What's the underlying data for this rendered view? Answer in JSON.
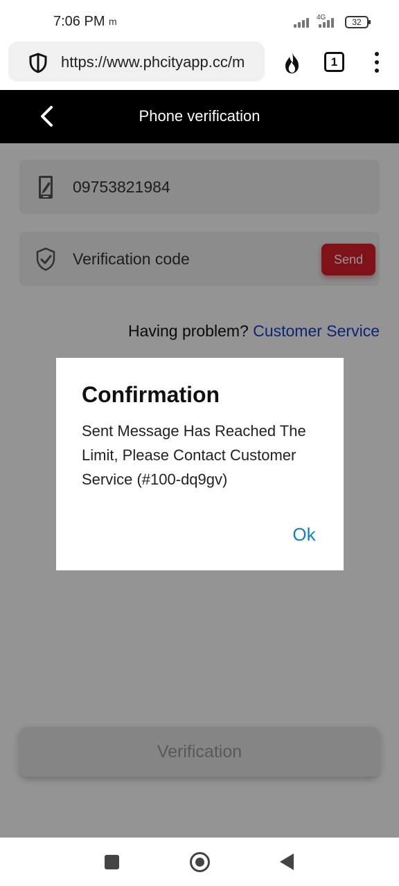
{
  "status_bar": {
    "time": "7:06 PM",
    "notification": "m",
    "network_type": "4G",
    "battery": "32",
    "icons": [
      "signal-icon",
      "signal-icon",
      "battery-icon"
    ]
  },
  "browser": {
    "url": "https://www.phcityapp.cc/m",
    "tab_count": "1",
    "icons": [
      "shield-icon",
      "fire-icon",
      "tabs-icon",
      "menu-dots-icon"
    ]
  },
  "header": {
    "title": "Phone verification",
    "back_icon": "back-arrow-icon"
  },
  "form": {
    "phone_number": "09753821984",
    "phone_icon": "phone-edit-icon",
    "verification_placeholder": "Verification code",
    "verification_icon": "shield-check-icon",
    "send_label": "Send",
    "help_text": "Having problem?",
    "customer_service": "Customer Service",
    "verification_button": "Verification"
  },
  "dialog": {
    "title": "Confirmation",
    "message": "Sent Message Has Reached The Limit, Please Contact Customer Service (#100-dq9gv)",
    "ok_label": "Ok"
  },
  "nav": {
    "icons": [
      "recent-apps-icon",
      "home-icon",
      "back-icon"
    ]
  },
  "colors": {
    "primary_red": "#d91f2a",
    "link_blue": "#173ec8",
    "dialog_ok_blue": "#0e82c8",
    "header_black": "#000000"
  }
}
